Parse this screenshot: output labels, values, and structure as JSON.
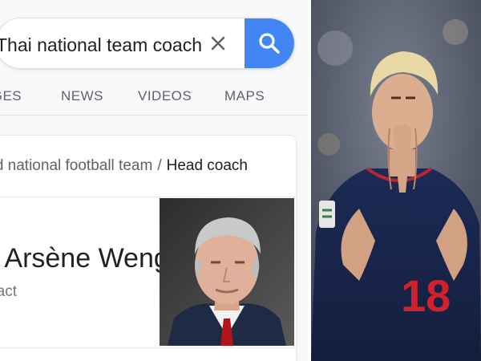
{
  "search": {
    "query": "Thai national team coach",
    "clear_icon": "close-icon",
    "search_icon": "search-icon",
    "accent_color": "#4285f4"
  },
  "tabs": [
    {
      "label": "IMAGES"
    },
    {
      "label": "NEWS"
    },
    {
      "label": "VIDEOS"
    },
    {
      "label": "MAPS"
    }
  ],
  "result": {
    "breadcrumb_parent": "Thailand national football team",
    "breadcrumb_current": "Head coach",
    "entity_name": "Arsène Wenger",
    "entity_subtitle": "Contract"
  },
  "photos": {
    "coach_photo": "portrait of grey-haired man in suit",
    "player_photo": "blond footballer in navy jersey number 18 with hands pressed together"
  }
}
